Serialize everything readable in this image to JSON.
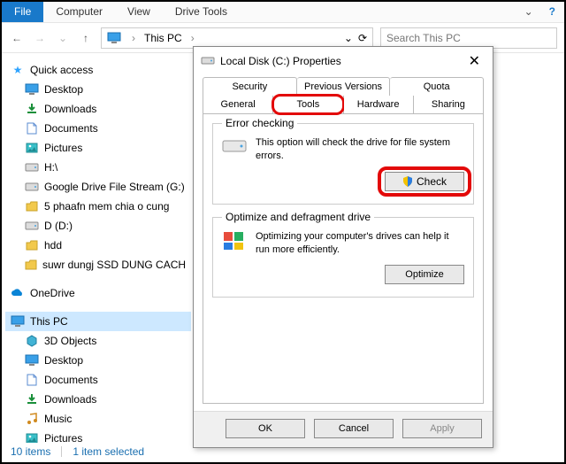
{
  "menubar": {
    "file": "File",
    "computer": "Computer",
    "view": "View",
    "drive_tools": "Drive Tools",
    "help": "?",
    "caret": "⌄"
  },
  "nav": {
    "back": "←",
    "forward": "→",
    "up": "↑",
    "crumb": "This PC",
    "dropdown": "⌄",
    "refresh": "⟳",
    "search_placeholder": "Search This PC"
  },
  "tree": {
    "quick_access": "Quick access",
    "items_qa": [
      {
        "label": "Desktop",
        "icon": "desktop"
      },
      {
        "label": "Downloads",
        "icon": "downloads"
      },
      {
        "label": "Documents",
        "icon": "documents"
      },
      {
        "label": "Pictures",
        "icon": "pictures"
      },
      {
        "label": "H:\\",
        "icon": "drive"
      },
      {
        "label": "Google Drive File Stream (G:)",
        "icon": "drive"
      },
      {
        "label": "5 phaafn mem chia o cung",
        "icon": "folder"
      },
      {
        "label": "D (D:)",
        "icon": "drive"
      },
      {
        "label": "hdd",
        "icon": "folder"
      },
      {
        "label": "suwr dungj SSD DUNG CACH",
        "icon": "folder"
      }
    ],
    "onedrive": "OneDrive",
    "this_pc": "This PC",
    "items_pc": [
      {
        "label": "3D Objects",
        "icon": "3d"
      },
      {
        "label": "Desktop",
        "icon": "desktop"
      },
      {
        "label": "Documents",
        "icon": "documents"
      },
      {
        "label": "Downloads",
        "icon": "downloads"
      },
      {
        "label": "Music",
        "icon": "music"
      },
      {
        "label": "Pictures",
        "icon": "pictures"
      }
    ]
  },
  "status": {
    "items": "10 items",
    "selected": "1 item selected"
  },
  "dialog": {
    "title": "Local Disk (C:) Properties",
    "close": "✕",
    "tabs_top": [
      "Security",
      "Previous Versions",
      "Quota"
    ],
    "tabs_bottom": [
      "General",
      "Tools",
      "Hardware",
      "Sharing"
    ],
    "error_checking": {
      "legend": "Error checking",
      "desc": "This option will check the drive for file system errors.",
      "button": "Check"
    },
    "optimize": {
      "legend": "Optimize and defragment drive",
      "desc": "Optimizing your computer's drives can help it run more efficiently.",
      "button": "Optimize"
    },
    "buttons": {
      "ok": "OK",
      "cancel": "Cancel",
      "apply": "Apply"
    }
  }
}
